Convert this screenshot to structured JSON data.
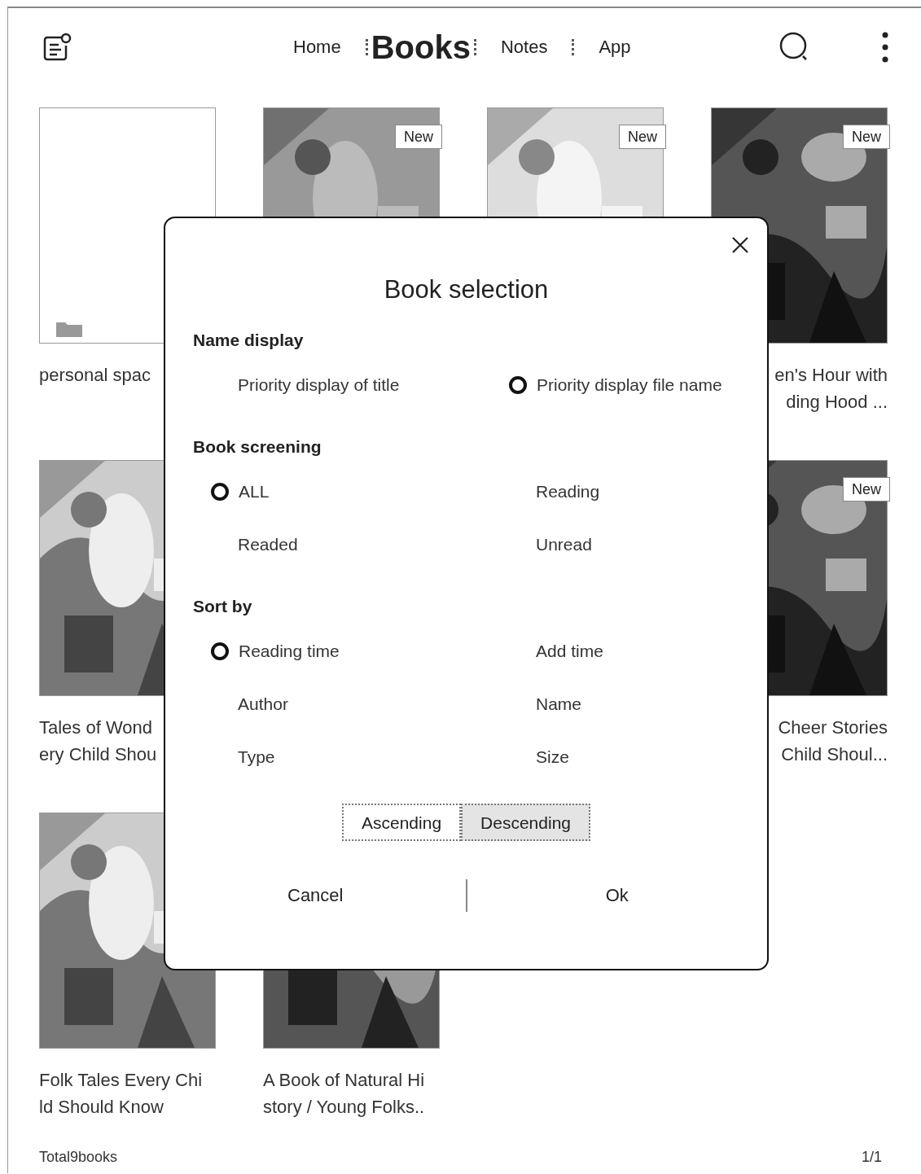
{
  "header": {
    "tabs": [
      {
        "label": "Home",
        "selected": false
      },
      {
        "label": "Books",
        "selected": true
      },
      {
        "label": "Notes",
        "selected": false
      },
      {
        "label": "App",
        "selected": false
      }
    ]
  },
  "shelf": [
    [
      {
        "kind": "folder",
        "title_lines": [
          "personal spac"
        ]
      },
      {
        "kind": "picture",
        "badge": "New"
      },
      {
        "kind": "picture",
        "badge": "New"
      },
      {
        "kind": "picture",
        "badge": "New",
        "title_lines": [
          "en's Hour with",
          "ding Hood ..."
        ]
      }
    ],
    [
      {
        "kind": "picture",
        "title_lines": [
          "Tales of Wond",
          "ery Child Shou"
        ]
      },
      {
        "kind": "picture",
        "badge": "New",
        "title_lines": [
          "Cheer Stories",
          "Child Shoul..."
        ]
      }
    ],
    [
      {
        "kind": "picture",
        "title_lines": [
          "Folk Tales Every Chi",
          "ld Should Know"
        ]
      },
      {
        "kind": "picture",
        "title_lines": [
          "A Book of Natural Hi",
          "story / Young Folks.."
        ]
      }
    ]
  ],
  "footer": {
    "total": "Total9books",
    "page": "1/1"
  },
  "dialog": {
    "title": "Book selection",
    "sections": [
      {
        "heading": "Name display",
        "options": [
          {
            "label": "Priority display of title",
            "selected": false
          },
          {
            "label": "Priority display file name",
            "selected": true
          }
        ]
      },
      {
        "heading": "Book screening",
        "options": [
          {
            "label": "ALL",
            "selected": true
          },
          {
            "label": "Reading",
            "selected": false
          },
          {
            "label": "Readed",
            "selected": false
          },
          {
            "label": "Unread",
            "selected": false
          }
        ]
      },
      {
        "heading": "Sort by",
        "options": [
          {
            "label": "Reading time",
            "selected": true
          },
          {
            "label": "Add time",
            "selected": false
          },
          {
            "label": "Author",
            "selected": false
          },
          {
            "label": "Name",
            "selected": false
          },
          {
            "label": "Type",
            "selected": false
          },
          {
            "label": "Size",
            "selected": false
          }
        ]
      }
    ],
    "order": [
      {
        "label": "Ascending",
        "selected": false
      },
      {
        "label": "Descending",
        "selected": true
      }
    ],
    "buttons": [
      "Cancel",
      "Ok"
    ]
  }
}
